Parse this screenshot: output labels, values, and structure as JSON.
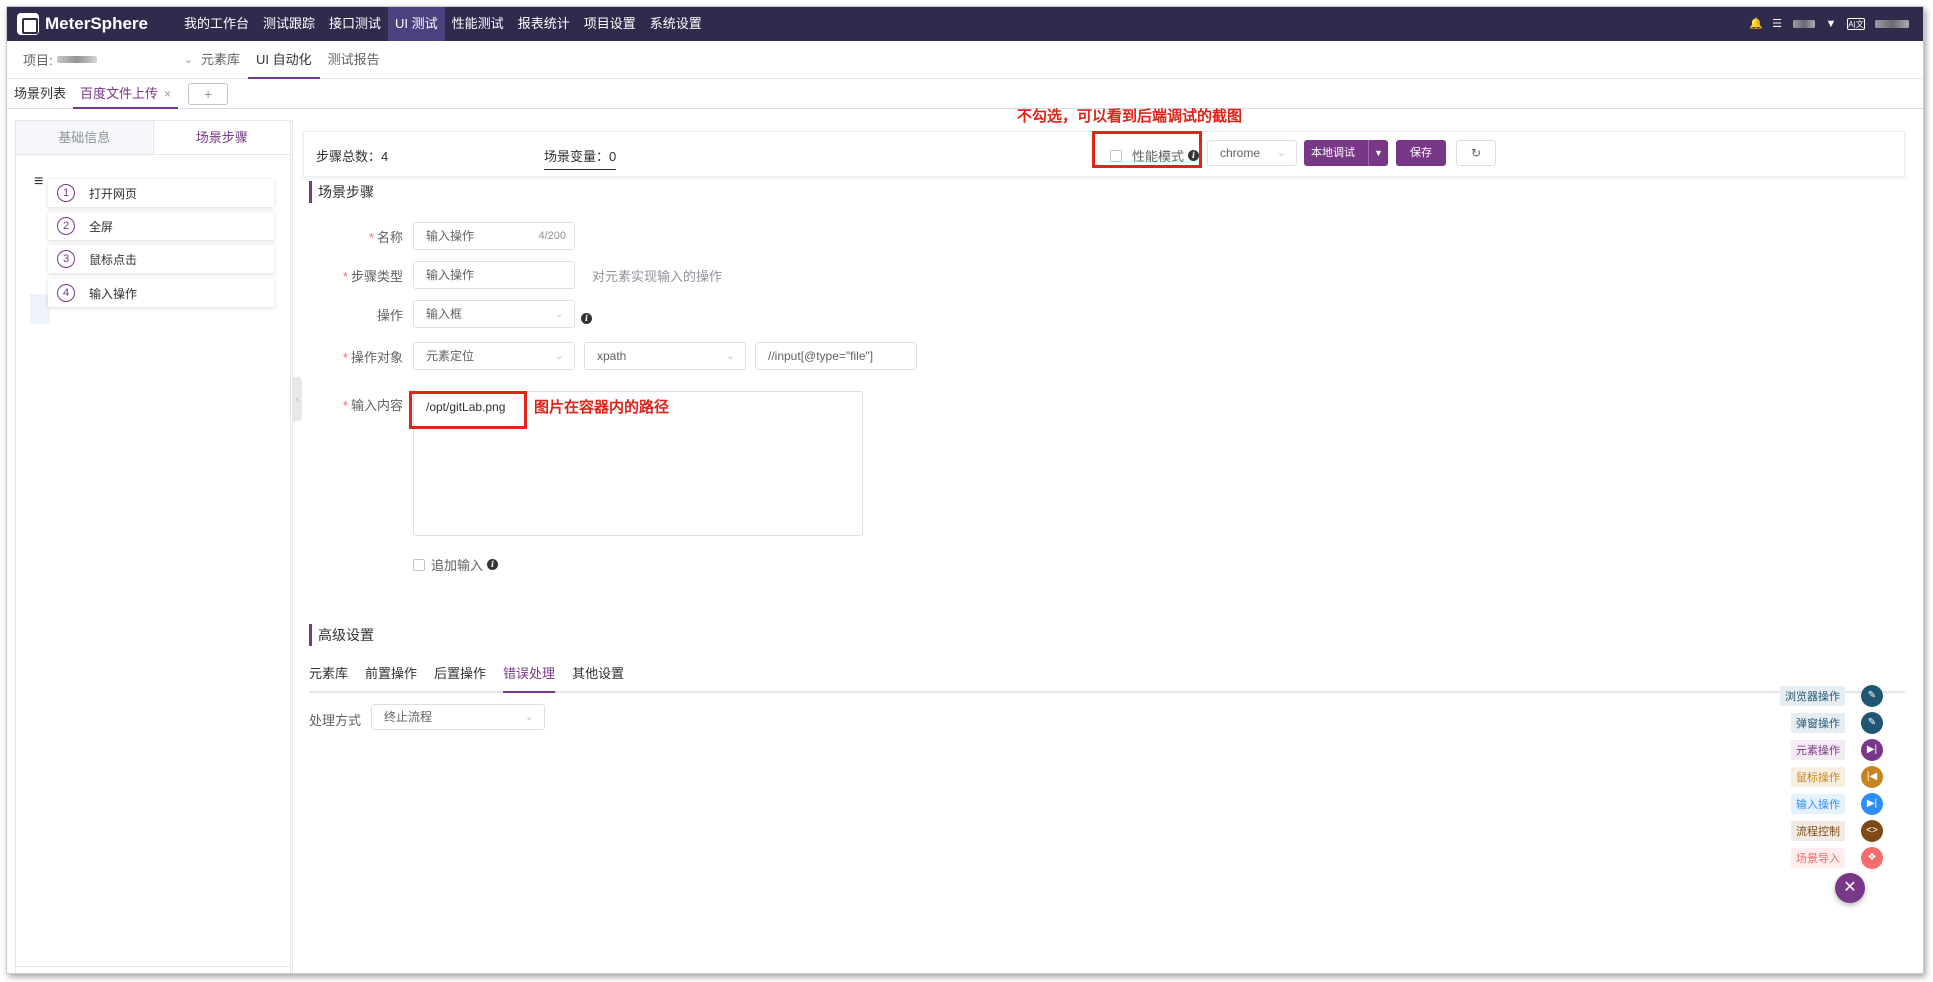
{
  "brand": {
    "name": "MeterSphere"
  },
  "topnav": {
    "items": [
      {
        "label": "我的工作台"
      },
      {
        "label": "测试跟踪"
      },
      {
        "label": "接口测试"
      },
      {
        "label": "UI 测试"
      },
      {
        "label": "性能测试"
      },
      {
        "label": "报表统计"
      },
      {
        "label": "项目设置"
      },
      {
        "label": "系统设置"
      }
    ],
    "active_index": 3
  },
  "subnav": {
    "project_label": "项目:",
    "items": [
      {
        "label": "元素库"
      },
      {
        "label": "UI 自动化"
      },
      {
        "label": "测试报告"
      }
    ]
  },
  "scene_tabs": {
    "list_label": "场景列表",
    "open_tab": "百度文件上传",
    "close_glyph": "×",
    "add_glyph": "+"
  },
  "left_panel": {
    "tabs": [
      {
        "label": "基础信息"
      },
      {
        "label": "场景步骤"
      }
    ],
    "steps": [
      {
        "num": "1",
        "label": "打开网页"
      },
      {
        "num": "2",
        "label": "全屏"
      },
      {
        "num": "3",
        "label": "鼠标点击"
      },
      {
        "num": "4",
        "label": "输入操作"
      }
    ]
  },
  "toolbar": {
    "step_total_label": "步骤总数：4",
    "scene_var_label": "场景变量：0",
    "perf_mode_label": "性能模式",
    "browser": "chrome",
    "local_debug": "本地调试",
    "save": "保存"
  },
  "annotations": {
    "perf_note": "不勾选，可以看到后端调试的截图",
    "path_note": "图片在容器内的路径"
  },
  "form": {
    "section_title": "场景步骤",
    "name_label": "名称",
    "name_value": "输入操作",
    "name_count": "4/200",
    "step_type_label": "步骤类型",
    "step_type_value": "输入操作",
    "step_type_hint": "对元素实现输入的操作",
    "op_label": "操作",
    "op_value": "输入框",
    "target_label": "操作对象",
    "target_locate": "元素定位",
    "target_method": "xpath",
    "target_expr": "//input[@type=\"file\"]",
    "content_label": "输入内容",
    "content_value": "/opt/gitLab.png",
    "append_label": "追加输入"
  },
  "advanced": {
    "section_title": "高级设置",
    "tabs": [
      {
        "label": "元素库"
      },
      {
        "label": "前置操作"
      },
      {
        "label": "后置操作"
      },
      {
        "label": "错误处理"
      },
      {
        "label": "其他设置"
      }
    ],
    "handling_label": "处理方式",
    "handling_value": "终止流程"
  },
  "fab_menu": {
    "items": [
      {
        "label": "浏览器操作",
        "color": "#1f5673",
        "label_bg": "#e7eef3"
      },
      {
        "label": "弹窗操作",
        "color": "#1f5673",
        "label_bg": "#e7eef3"
      },
      {
        "label": "元素操作",
        "color": "#783887",
        "label_bg": "#f2ebf3"
      },
      {
        "label": "鼠标操作",
        "color": "#c7851f",
        "label_bg": "#f8efe1"
      },
      {
        "label": "输入操作",
        "color": "#2c8ef8",
        "label_bg": "#e6f1fe"
      },
      {
        "label": "流程控制",
        "color": "#7c4a16",
        "label_bg": "#f1ebe4"
      },
      {
        "label": "场景导入",
        "color": "#f56c6c",
        "label_bg": "#fdeded"
      }
    ]
  },
  "colors": {
    "accent": "#783887",
    "nav_bg": "#2e2b4d",
    "annotation": "#e2231a"
  }
}
